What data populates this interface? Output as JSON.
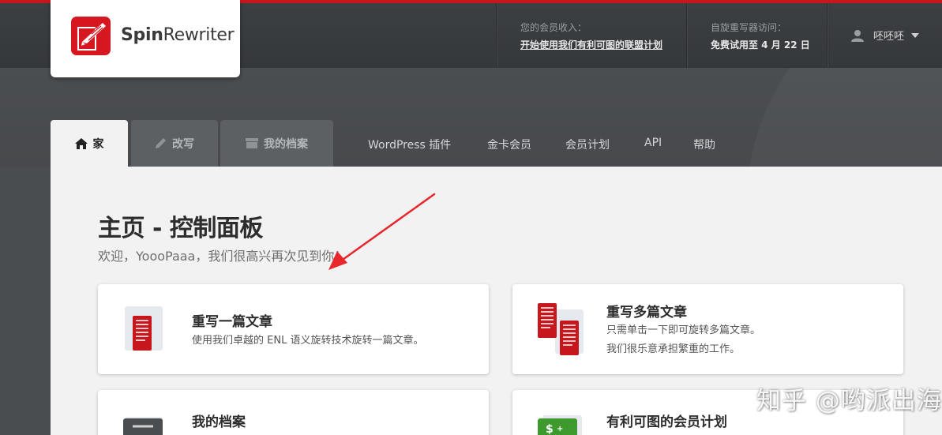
{
  "brand": {
    "name_bold": "Spin",
    "name_light": "Rewriter"
  },
  "header": {
    "affiliate_label": "您的会员收入：",
    "affiliate_link": "开始使用我们有利可图的联盟计划",
    "access_label": "自旋重写器访问：",
    "access_value": "免费试用至 4 月 22 日",
    "user_name": "呸呸呸"
  },
  "tabs": [
    {
      "label": "家",
      "icon": "home-icon"
    },
    {
      "label": "改写",
      "icon": "pencil-icon"
    },
    {
      "label": "我的档案",
      "icon": "folder-icon"
    }
  ],
  "nav": [
    "WordPress 插件",
    "金卡会员",
    "会员计划",
    "API",
    "帮助"
  ],
  "page": {
    "title": "主页 - 控制面板",
    "subtitle": "欢迎，YoooPaaa，我们很高兴再次见到你！"
  },
  "cards": [
    {
      "title": "重写一篇文章",
      "lines": [
        "使用我们卓越的 ENL 语义旋转技术旋转一篇文章。"
      ],
      "icon": "single-document-icon"
    },
    {
      "title": "重写多篇文章",
      "lines": [
        "只需单击一下即可旋转多篇文章。",
        "我们很乐意承担繁重的工作。"
      ],
      "icon": "multiple-documents-icon"
    },
    {
      "title": "我的档案",
      "lines": [],
      "icon": "archive-icon"
    },
    {
      "title": "有利可图的会员计划",
      "lines": [],
      "icon": "money-icon"
    }
  ],
  "watermark": "知乎 @哟派出海",
  "colors": {
    "accent_red": "#c8161d",
    "header_dark": "#3c3f42",
    "content_bg": "#f2f2f2"
  }
}
